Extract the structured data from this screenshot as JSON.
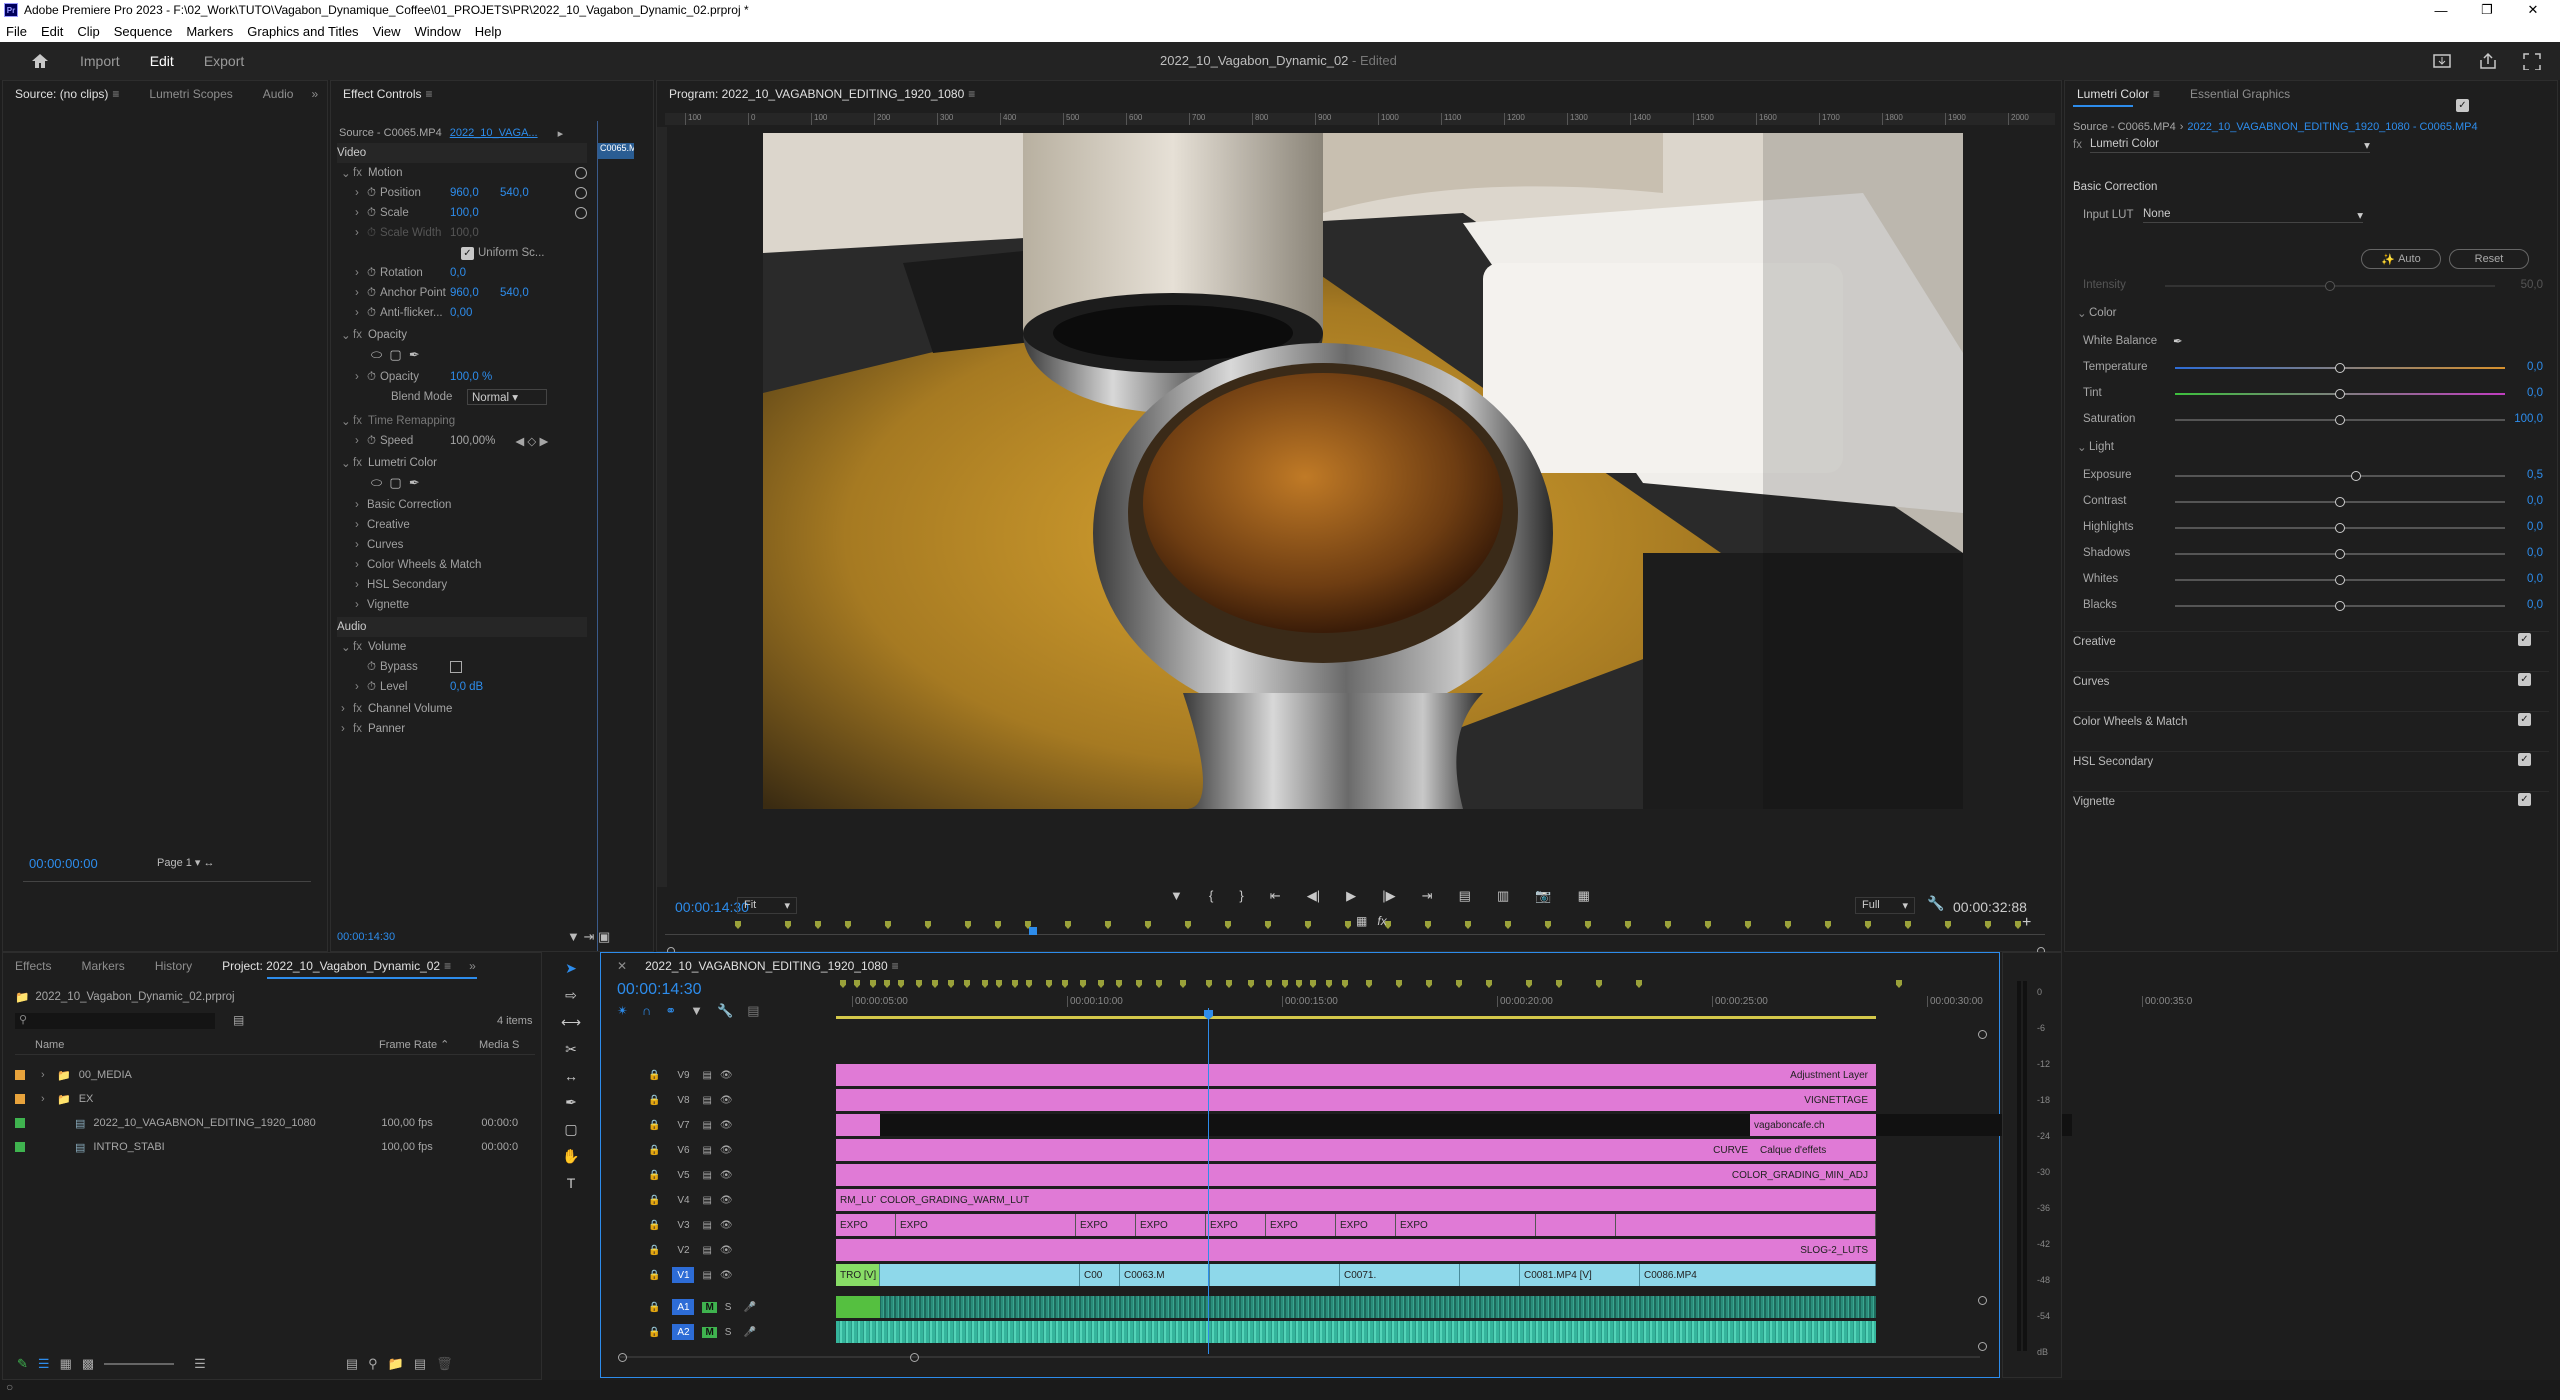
{
  "titlebar": {
    "title": "Adobe Premiere Pro 2023 - F:\\02_Work\\TUTO\\Vagabon_Dynamique_Coffee\\01_PROJETS\\PR\\2022_10_Vagabon_Dynamic_02.prproj *",
    "logo": "Pr"
  },
  "menu": [
    "File",
    "Edit",
    "Clip",
    "Sequence",
    "Markers",
    "Graphics and Titles",
    "View",
    "Window",
    "Help"
  ],
  "workspace": {
    "tabs": [
      "Import",
      "Edit",
      "Export"
    ],
    "active": "Edit",
    "project_name": "2022_10_Vagabon_Dynamic_02",
    "status": "- Edited"
  },
  "source_panel": {
    "tabs": [
      "Source: (no clips)",
      "Lumetri Scopes",
      "Audio"
    ],
    "timecode": "00:00:00:00",
    "page": "Page 1"
  },
  "effect_controls": {
    "tab": "Effect Controls",
    "source": "Source - C0065.MP4",
    "sequence": "2022_10_VAGA...",
    "clip_label": "C0065.M",
    "video_header": "Video",
    "motion": "Motion",
    "position_label": "Position",
    "position_x": "960,0",
    "position_y": "540,0",
    "scale_label": "Scale",
    "scale_val": "100,0",
    "scale_width_label": "Scale Width",
    "scale_width_val": "100,0",
    "uniform_label": "Uniform Sc...",
    "rotation_label": "Rotation",
    "rotation_val": "0,0",
    "anchor_label": "Anchor Point",
    "anchor_x": "960,0",
    "anchor_y": "540,0",
    "antiflicker_label": "Anti-flicker...",
    "antiflicker_val": "0,00",
    "opacity_header": "Opacity",
    "opacity_label": "Opacity",
    "opacity_val": "100,0 %",
    "blend_label": "Blend Mode",
    "blend_val": "Normal",
    "time_remap": "Time Remapping",
    "speed_label": "Speed",
    "speed_val": "100,00%",
    "lumetri": "Lumetri Color",
    "lumetri_items": [
      "Basic Correction",
      "Creative",
      "Curves",
      "Color Wheels & Match",
      "HSL Secondary",
      "Vignette"
    ],
    "audio_header": "Audio",
    "volume": "Volume",
    "bypass_label": "Bypass",
    "level_label": "Level",
    "level_val": "0,0 dB",
    "channel_volume": "Channel Volume",
    "panner": "Panner",
    "timecode": "00:00:14:30"
  },
  "program": {
    "title": "Program: 2022_10_VAGABNON_EDITING_1920_1080",
    "timecode": "00:00:14:30",
    "fit": "Fit",
    "full": "Full",
    "duration": "00:00:32:88",
    "ruler": [
      "100",
      "0",
      "100",
      "200",
      "300",
      "400",
      "500",
      "600",
      "700",
      "800",
      "900",
      "1000",
      "1100",
      "1200",
      "1300",
      "1400",
      "1500",
      "1600",
      "1700",
      "1800",
      "1900",
      "2000"
    ]
  },
  "lumetri": {
    "tabs": [
      "Lumetri Color",
      "Essential Graphics"
    ],
    "source": "Source - C0065.MP4",
    "sequence_link": "2022_10_VAGABNON_EDITING_1920_1080 - C0065.MP4",
    "effect": "Lumetri Color",
    "basic_correction": "Basic Correction",
    "input_lut_label": "Input LUT",
    "input_lut_val": "None",
    "auto_btn": "Auto",
    "reset_btn": "Reset",
    "intensity_label": "Intensity",
    "intensity_val": "50,0",
    "color_header": "Color",
    "wb_label": "White Balance",
    "temperature_label": "Temperature",
    "temperature_val": "0,0",
    "tint_label": "Tint",
    "tint_val": "0,0",
    "saturation_label": "Saturation",
    "saturation_val": "100,0",
    "light_header": "Light",
    "exposure_label": "Exposure",
    "exposure_val": "0,5",
    "contrast_label": "Contrast",
    "contrast_val": "0,0",
    "highlights_label": "Highlights",
    "highlights_val": "0,0",
    "shadows_label": "Shadows",
    "shadows_val": "0,0",
    "whites_label": "Whites",
    "whites_val": "0,0",
    "blacks_label": "Blacks",
    "blacks_val": "0,0",
    "sections": [
      "Creative",
      "Curves",
      "Color Wheels & Match",
      "HSL Secondary",
      "Vignette"
    ]
  },
  "project_panel": {
    "tabs": [
      "Effects",
      "Markers",
      "History",
      "Project: 2022_10_Vagabon_Dynamic_02"
    ],
    "file": "2022_10_Vagabon_Dynamic_02.prproj",
    "count": "4 items",
    "col_name": "Name",
    "col_fps": "Frame Rate",
    "col_media": "Media S",
    "items": [
      {
        "name": "00_MEDIA",
        "fps": "",
        "media": "",
        "color": "#e8a33c",
        "type": "folder"
      },
      {
        "name": "EX",
        "fps": "",
        "media": "",
        "color": "#e8a33c",
        "type": "folder"
      },
      {
        "name": "2022_10_VAGABNON_EDITING_1920_1080",
        "fps": "100,00 fps",
        "media": "00:00:0",
        "color": "#3fb34f",
        "type": "sequence"
      },
      {
        "name": "INTRO_STABI",
        "fps": "100,00 fps",
        "media": "00:00:0",
        "color": "#3fb34f",
        "type": "sequence"
      }
    ]
  },
  "timeline": {
    "tab": "2022_10_VAGABNON_EDITING_1920_1080",
    "timecode": "00:00:14:30",
    "ruler": [
      "00:00:05:00",
      "00:00:10:00",
      "00:00:15:00",
      "00:00:20:00",
      "00:00:25:00",
      "00:00:30:00",
      "00:00:35:0"
    ],
    "tracks": [
      "V9",
      "V8",
      "V7",
      "V6",
      "V5",
      "V4",
      "V3",
      "V2",
      "V1",
      "A1",
      "A2"
    ],
    "clips": {
      "v9": "Adjustment Layer",
      "v8": "VIGNETTAGE",
      "v7": "vagaboncafe.ch",
      "v6a": "CURVE",
      "v6b": "Calque d'effets",
      "v5": "COLOR_GRADING_MIN_ADJ",
      "v4a": "RM_LUT",
      "v4b": "COLOR_GRADING_WARM_LUT",
      "v3": [
        "EXPO",
        "EXPO",
        "EXPO",
        "EXPO",
        "EXPO",
        "EXPO",
        "EXPO",
        "EXPO"
      ],
      "v2": "SLOG-2_LUTS",
      "v1": [
        "TRO [V]",
        "C00",
        "C0063.M",
        "C0071.",
        "C0081.MP4 [V]",
        "C0086.MP4"
      ]
    },
    "meter_labels": [
      "0",
      "-6",
      "-12",
      "-18",
      "-24",
      "-30",
      "-36",
      "-42",
      "-48",
      "-54",
      "dB"
    ]
  }
}
